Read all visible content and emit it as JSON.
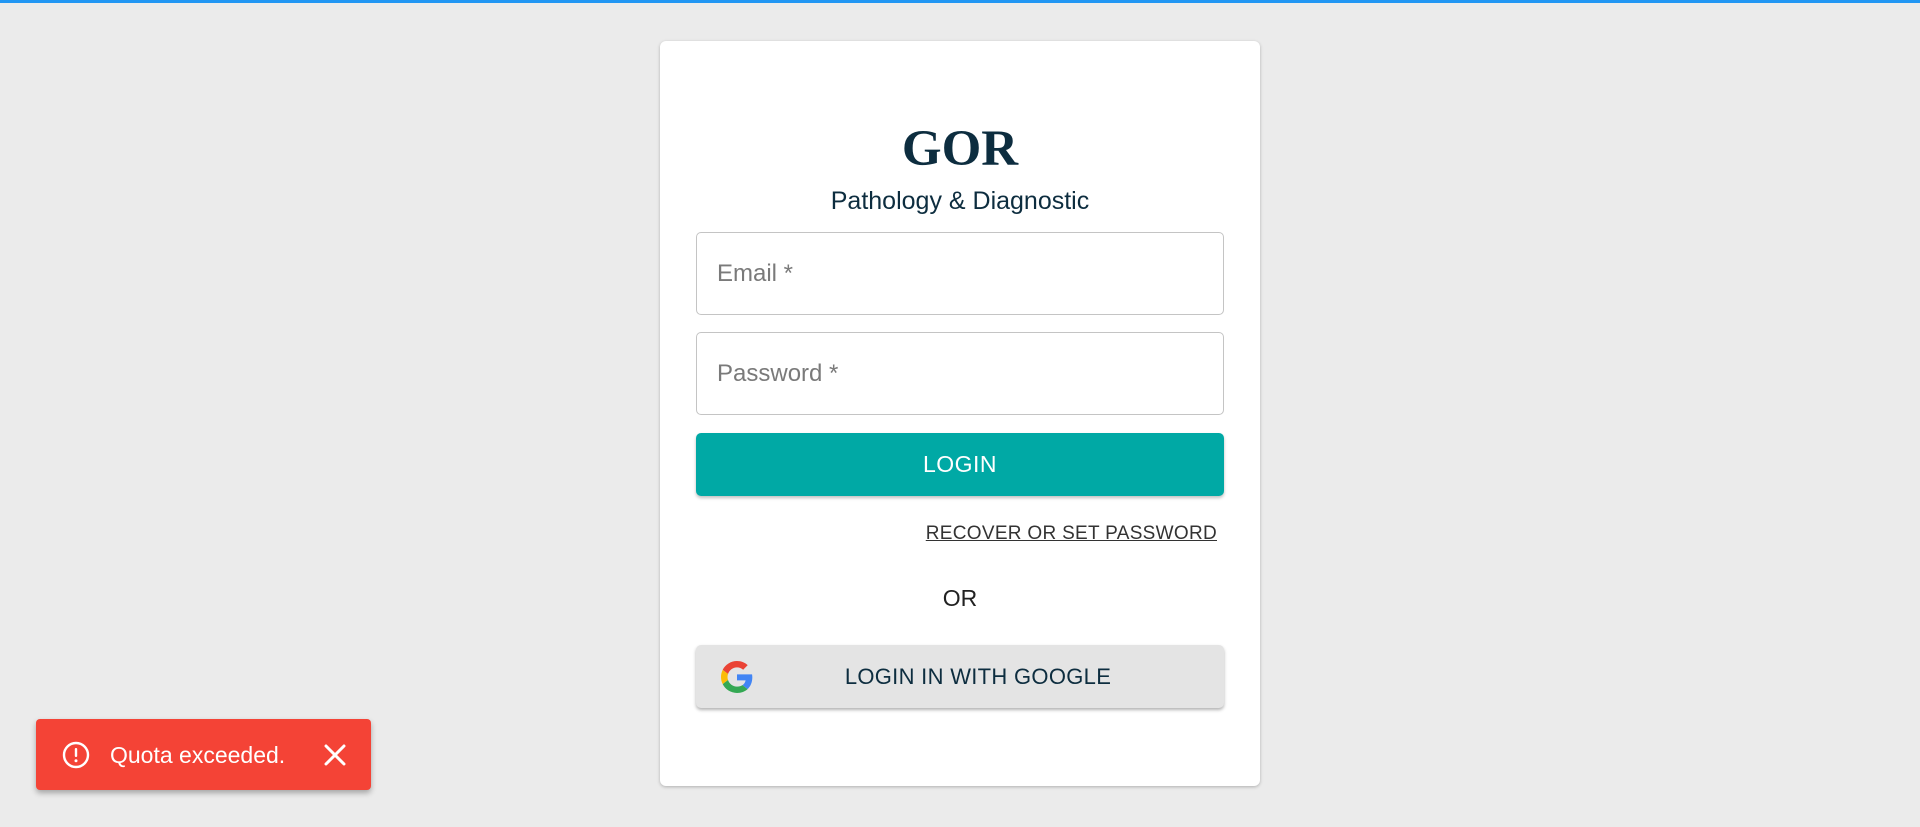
{
  "brand": {
    "title": "GOR",
    "subtitle": "Pathology & Diagnostic"
  },
  "form": {
    "email_placeholder": "Email *",
    "password_placeholder": "Password *",
    "login_label": "LOGIN",
    "recover_label": "RECOVER OR SET PASSWORD",
    "or_label": "OR",
    "google_label": "LOGIN IN WITH GOOGLE"
  },
  "toast": {
    "message": "Quota exceeded.",
    "icon": "alert-circle-icon",
    "close_icon": "close-icon"
  },
  "colors": {
    "accent_top_bar": "#2196f3",
    "login_button": "#00a9a5",
    "toast_error": "#f44336",
    "brand_text": "#0d2d3f",
    "page_background": "#ebebeb"
  }
}
